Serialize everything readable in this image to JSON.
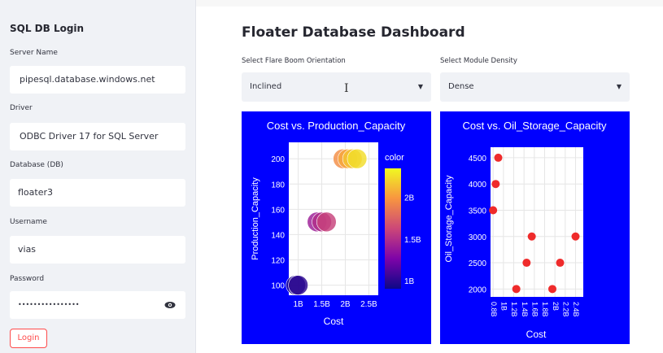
{
  "sidebar": {
    "title": "SQL DB Login",
    "server_label": "Server Name",
    "server_value": "pipesql.database.windows.net",
    "driver_label": "Driver",
    "driver_value": "ODBC Driver 17 for SQL Server",
    "db_label": "Database (DB)",
    "db_value": "floater3",
    "user_label": "Username",
    "user_value": "vias",
    "password_label": "Password",
    "password_value": "••••••••••••••••",
    "login_label": "Login"
  },
  "main": {
    "title": "Floater Database Dashboard",
    "orientation_label": "Select Flare Boom Orientation",
    "orientation_value": "Inclined",
    "density_label": "Select Module Density",
    "density_value": "Dense"
  },
  "icons": {
    "eye": "eye-icon",
    "caret": "chevron-down-icon",
    "cursor": "text-cursor-icon"
  },
  "colors": {
    "chart_bg": "#0000ff",
    "login_accent": "#ff4b4b"
  },
  "chart_data": [
    {
      "type": "scatter",
      "title": "Cost vs. Production_Capacity",
      "xlabel": "Cost",
      "ylabel": "Production_Capacity",
      "x_ticks": [
        "1B",
        "1.5B",
        "2B",
        "2.5B"
      ],
      "y_ticks": [
        100,
        120,
        140,
        160,
        180,
        200
      ],
      "xlim": [
        0.8,
        2.7
      ],
      "ylim": [
        92,
        213
      ],
      "colorbar": {
        "title": "color",
        "ticks": [
          "1B",
          "1.5B",
          "2B"
        ],
        "range": [
          0.9,
          2.35
        ]
      },
      "points": [
        {
          "x": 0.95,
          "y": 100,
          "c": 0.95
        },
        {
          "x": 1.0,
          "y": 100,
          "c": 1.0
        },
        {
          "x": 1.4,
          "y": 150,
          "c": 1.4
        },
        {
          "x": 1.5,
          "y": 150,
          "c": 1.5
        },
        {
          "x": 1.6,
          "y": 150,
          "c": 1.6
        },
        {
          "x": 1.95,
          "y": 200,
          "c": 1.95
        },
        {
          "x": 2.05,
          "y": 200,
          "c": 2.05
        },
        {
          "x": 2.15,
          "y": 200,
          "c": 2.15
        },
        {
          "x": 2.25,
          "y": 200,
          "c": 2.25
        }
      ]
    },
    {
      "type": "scatter",
      "title": "Cost vs. Oil_Storage_Capacity",
      "xlabel": "Cost",
      "ylabel": "Oil_Storage_Capacity",
      "x_ticks": [
        "0.8B",
        "1B",
        "1.2B",
        "1.4B",
        "1.6B",
        "1.8B",
        "2B",
        "2.2B",
        "2.4B"
      ],
      "y_ticks": [
        2000,
        2500,
        3000,
        3500,
        4000,
        4500
      ],
      "xlim": [
        0.75,
        2.55
      ],
      "ylim": [
        1850,
        4700
      ],
      "points": [
        {
          "x": 0.8,
          "y": 3500
        },
        {
          "x": 0.85,
          "y": 4000
        },
        {
          "x": 0.9,
          "y": 4500
        },
        {
          "x": 1.25,
          "y": 2000
        },
        {
          "x": 1.45,
          "y": 2500
        },
        {
          "x": 1.55,
          "y": 3000
        },
        {
          "x": 1.95,
          "y": 2000
        },
        {
          "x": 2.1,
          "y": 2500
        },
        {
          "x": 2.4,
          "y": 3000
        }
      ]
    }
  ]
}
